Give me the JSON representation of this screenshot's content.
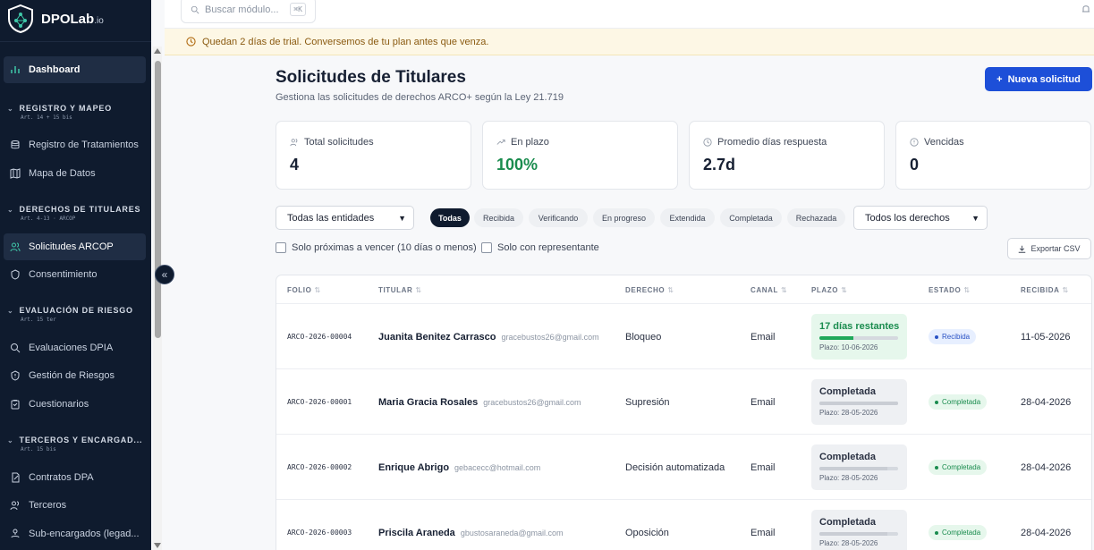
{
  "brand": {
    "name": "DPOLab",
    "suffix": ".io"
  },
  "sidebar": {
    "dashboard": "Dashboard",
    "sections": [
      {
        "title": "REGISTRO Y MAPEO",
        "sub": "Art. 14 + 15 bis",
        "items": [
          "Registro de Tratamientos",
          "Mapa de Datos"
        ]
      },
      {
        "title": "DERECHOS DE TITULARES",
        "sub": "Art. 4-13 · ARCOP",
        "items": [
          "Solicitudes ARCOP",
          "Consentimiento"
        ]
      },
      {
        "title": "EVALUACIÓN DE RIESGO",
        "sub": "Art. 15 ter",
        "items": [
          "Evaluaciones DPIA",
          "Gestión de Riesgos",
          "Cuestionarios"
        ]
      },
      {
        "title": "TERCEROS Y ENCARGAD...",
        "sub": "Art. 15 bis",
        "items": [
          "Contratos DPA",
          "Terceros",
          "Sub-encargados (legad..."
        ]
      }
    ]
  },
  "topbar": {
    "search_placeholder": "Buscar módulo...",
    "shortcut": "⌘K"
  },
  "banner": {
    "text": "Quedan 2 días de trial. Conversemos de tu plan antes que venza."
  },
  "page": {
    "title": "Solicitudes de Titulares",
    "subtitle": "Gestiona las solicitudes de derechos ARCO+ según la Ley 21.719",
    "new_button": "Nueva solicitud"
  },
  "stats": [
    {
      "label": "Total solicitudes",
      "value": "4"
    },
    {
      "label": "En plazo",
      "value": "100%"
    },
    {
      "label": "Promedio días respuesta",
      "value": "2.7d"
    },
    {
      "label": "Vencidas",
      "value": "0"
    }
  ],
  "filters": {
    "entities": "Todas las entidades",
    "pills": [
      "Todas",
      "Recibida",
      "Verificando",
      "En progreso",
      "Extendida",
      "Completada",
      "Rechazada"
    ],
    "rights": "Todos los derechos",
    "check_expiring": "Solo próximas a vencer (10 días o menos)",
    "check_representative": "Solo con representante",
    "export": "Exportar CSV"
  },
  "table": {
    "headers": [
      "FOLIO",
      "TITULAR",
      "DERECHO",
      "CANAL",
      "PLAZO",
      "ESTADO",
      "RECIBIDA"
    ],
    "rows": [
      {
        "folio": "ARCO-2026-00004",
        "name": "Juanita Benitez Carrasco",
        "email": "gracebustos26@gmail.com",
        "right": "Bloqueo",
        "channel": "Email",
        "plazo_title": "17 días restantes",
        "plazo_date": "Plazo: 10-06-2026",
        "progress": 0.43,
        "status": "Recibida",
        "received": "11-05-2026"
      },
      {
        "folio": "ARCO-2026-00001",
        "name": "Maria Gracia Rosales",
        "email": "gracebustos26@gmail.com",
        "right": "Supresión",
        "channel": "Email",
        "plazo_title": "Completada",
        "plazo_date": "Plazo: 28-05-2026",
        "progress": 1.0,
        "status": "Completada",
        "received": "28-04-2026"
      },
      {
        "folio": "ARCO-2026-00002",
        "name": "Enrique Abrigo",
        "email": "gebacecc@hotmail.com",
        "right": "Decisión automatizada",
        "channel": "Email",
        "plazo_title": "Completada",
        "plazo_date": "Plazo: 28-05-2026",
        "progress": 0.86,
        "status": "Completada",
        "received": "28-04-2026"
      },
      {
        "folio": "ARCO-2026-00003",
        "name": "Priscila Araneda",
        "email": "gbustosaraneda@gmail.com",
        "right": "Oposición",
        "channel": "Email",
        "plazo_title": "Completada",
        "plazo_date": "Plazo: 28-05-2026",
        "progress": 0.86,
        "status": "Completada",
        "received": "28-04-2026"
      }
    ]
  },
  "colors": {
    "sidebar_bg": "#0f1b2e",
    "primary": "#1d4fd8",
    "success": "#1a8c4e",
    "banner_bg": "#fdf7e5"
  }
}
